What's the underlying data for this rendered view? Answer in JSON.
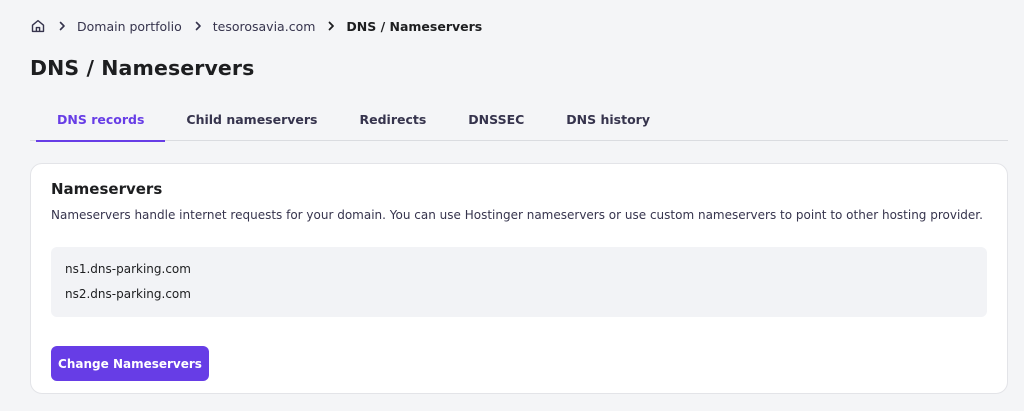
{
  "breadcrumb": {
    "home_icon": "home-icon",
    "separator_icon": "chevron-right-icon",
    "items": [
      {
        "label": "Domain portfolio"
      },
      {
        "label": "tesorosavia.com"
      },
      {
        "label": "DNS / Nameservers"
      }
    ]
  },
  "page": {
    "title": "DNS / Nameservers"
  },
  "tabs": [
    {
      "label": "DNS records",
      "active": true
    },
    {
      "label": "Child nameservers",
      "active": false
    },
    {
      "label": "Redirects",
      "active": false
    },
    {
      "label": "DNSSEC",
      "active": false
    },
    {
      "label": "DNS history",
      "active": false
    }
  ],
  "nameservers_card": {
    "title": "Nameservers",
    "description": "Nameservers handle internet requests for your domain. You can use Hostinger nameservers or use custom nameservers to point to other hosting provider.",
    "nameservers": [
      "ns1.dns-parking.com",
      "ns2.dns-parking.com"
    ],
    "button_label": "Change Nameservers"
  },
  "colors": {
    "accent": "#673de6",
    "background": "#f4f5f7",
    "card": "#ffffff",
    "ns_box": "#f2f3f6",
    "text_primary": "#1d1e20"
  }
}
